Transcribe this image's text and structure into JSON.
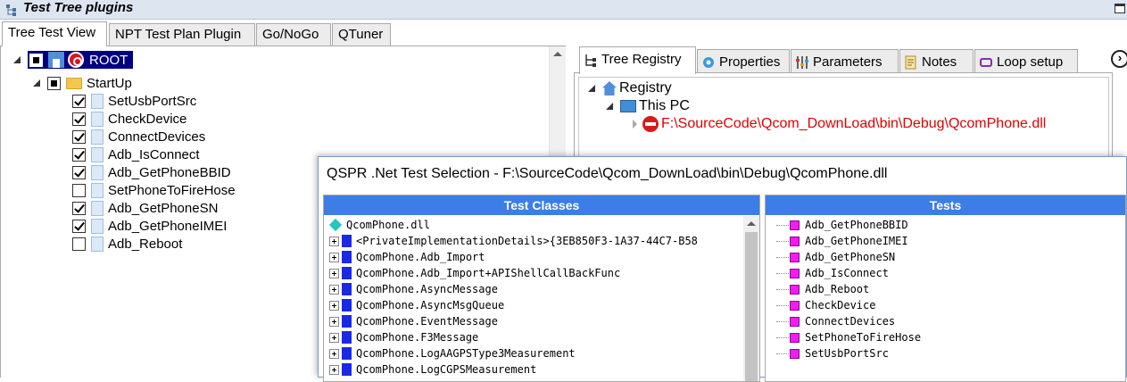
{
  "window": {
    "title": "Test Tree plugins"
  },
  "left_tabs": [
    {
      "label": "Tree Test View",
      "active": true
    },
    {
      "label": "NPT Test Plan Plugin",
      "active": false
    },
    {
      "label": "Go/NoGo",
      "active": false
    },
    {
      "label": "QTuner",
      "active": false
    }
  ],
  "tree": {
    "root_label": "ROOT",
    "group_label": "StartUp",
    "items": [
      {
        "label": "SetUsbPortSrc",
        "checked": true
      },
      {
        "label": "CheckDevice",
        "checked": true
      },
      {
        "label": "ConnectDevices",
        "checked": true
      },
      {
        "label": "Adb_IsConnect",
        "checked": true
      },
      {
        "label": "Adb_GetPhoneBBID",
        "checked": true
      },
      {
        "label": "SetPhoneToFireHose",
        "checked": false
      },
      {
        "label": "Adb_GetPhoneSN",
        "checked": true
      },
      {
        "label": "Adb_GetPhoneIMEI",
        "checked": true
      },
      {
        "label": "Adb_Reboot",
        "checked": false
      }
    ]
  },
  "right_tabs": [
    {
      "label": "Tree Registry",
      "icon": "tree-icon",
      "active": true
    },
    {
      "label": "Properties",
      "icon": "gear-icon",
      "active": false
    },
    {
      "label": "Parameters",
      "icon": "sliders-icon",
      "active": false
    },
    {
      "label": "Notes",
      "icon": "notes-icon",
      "active": false
    },
    {
      "label": "Loop setup",
      "icon": "loop-icon",
      "active": false
    }
  ],
  "registry": {
    "root": "Registry",
    "pc": "This PC",
    "dll_path": "F:\\SourceCode\\Qcom_DownLoad\\bin\\Debug\\QcomPhone.dll"
  },
  "dialog": {
    "title": "QSPR .Net Test Selection - F:\\SourceCode\\Qcom_DownLoad\\bin\\Debug\\QcomPhone.dll",
    "classes_header": "Test Classes",
    "tests_header": "Tests",
    "dll_name": "QcomPhone.dll",
    "classes": [
      "<PrivateImplementationDetails>{3EB850F3-1A37-44C7-B58",
      "QcomPhone.Adb_Import",
      "QcomPhone.Adb_Import+APIShellCallBackFunc",
      "QcomPhone.AsyncMessage",
      "QcomPhone.AsyncMsgQueue",
      "QcomPhone.EventMessage",
      "QcomPhone.F3Message",
      "QcomPhone.LogAAGPSType3Measurement",
      "QcomPhone.LogCGPSMeasurement"
    ],
    "tests": [
      "Adb_GetPhoneBBID",
      "Adb_GetPhoneIMEI",
      "Adb_GetPhoneSN",
      "Adb_IsConnect",
      "Adb_Reboot",
      "CheckDevice",
      "ConnectDevices",
      "SetPhoneToFireHose",
      "SetUsbPortSrc"
    ]
  },
  "colors": {
    "accent_header": "#3c7ee6",
    "root_highlight": "#000080",
    "error_text": "#e00000"
  }
}
